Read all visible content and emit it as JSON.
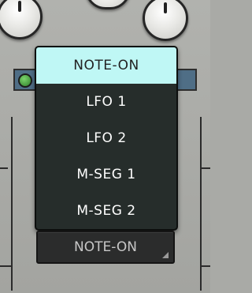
{
  "menu": {
    "items": [
      "NOTE-ON",
      "LFO 1",
      "LFO 2",
      "M-SEG 1",
      "M-SEG 2"
    ],
    "selected_index": 0
  },
  "select": {
    "value": "NOTE-ON"
  }
}
